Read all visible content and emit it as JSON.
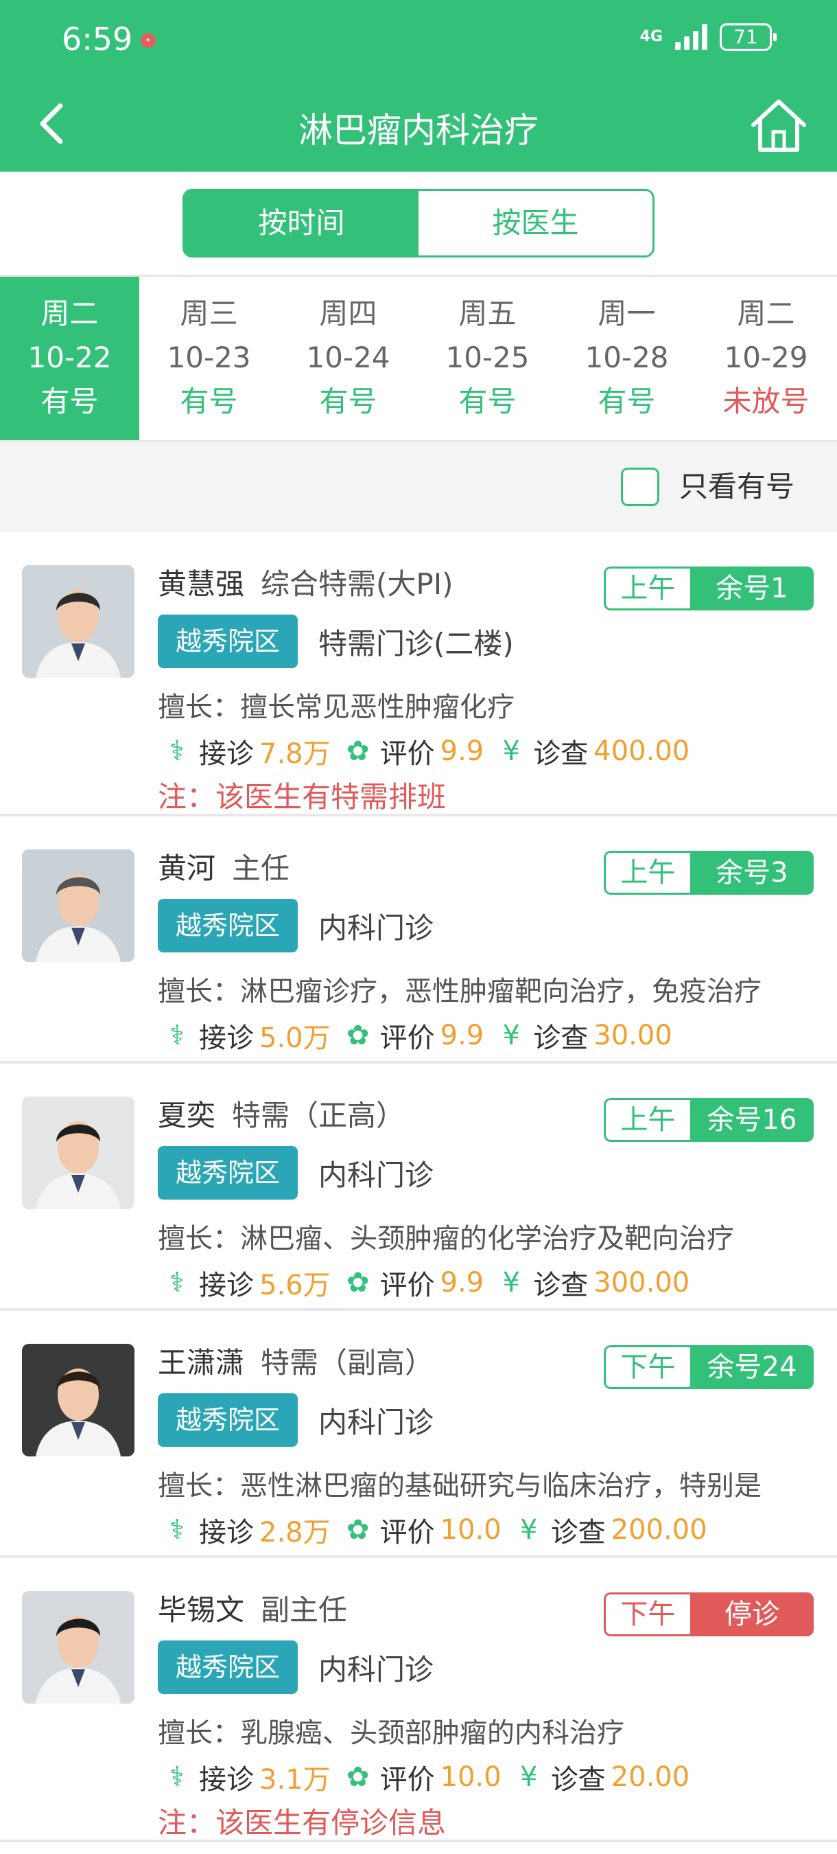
{
  "status_bar": {
    "time": "6:59",
    "network": "4G",
    "battery": "71"
  },
  "nav": {
    "title": "淋巴瘤内科治疗"
  },
  "toggle": {
    "by_time": "按时间",
    "by_doctor": "按医生"
  },
  "dates": [
    {
      "weekday": "周二",
      "date": "10-22",
      "status": "有号",
      "state": "selected"
    },
    {
      "weekday": "周三",
      "date": "10-23",
      "status": "有号",
      "state": "available"
    },
    {
      "weekday": "周四",
      "date": "10-24",
      "status": "有号",
      "state": "available"
    },
    {
      "weekday": "周五",
      "date": "10-25",
      "status": "有号",
      "state": "available"
    },
    {
      "weekday": "周一",
      "date": "10-28",
      "status": "有号",
      "state": "available"
    },
    {
      "weekday": "周二",
      "date": "10-29",
      "status": "未放号",
      "state": "unreleased"
    }
  ],
  "filter": {
    "label": "只看有号",
    "checked": false
  },
  "labels": {
    "visits": "接诊",
    "rating": "评价",
    "fee": "诊查",
    "spec_prefix": "擅长："
  },
  "doctors": [
    {
      "name": "黄慧强",
      "title": "综合特需(大PI)",
      "period": "上午",
      "remain": "余号1",
      "slot_state": "open",
      "campus": "越秀院区",
      "clinic": "特需门诊(二楼)",
      "specialty": "擅长常见恶性肿瘤化疗",
      "visits": "7.8万",
      "rating": "9.9",
      "fee": "400.00",
      "note": "注：该医生有特需排班"
    },
    {
      "name": "黄河",
      "title": "主任",
      "period": "上午",
      "remain": "余号3",
      "slot_state": "open",
      "campus": "越秀院区",
      "clinic": "内科门诊",
      "specialty": "淋巴瘤诊疗，恶性肿瘤靶向治疗，免疫治疗",
      "visits": "5.0万",
      "rating": "9.9",
      "fee": "30.00",
      "note": ""
    },
    {
      "name": "夏奕",
      "title": "特需（正高）",
      "period": "上午",
      "remain": "余号16",
      "slot_state": "open",
      "campus": "越秀院区",
      "clinic": "内科门诊",
      "specialty": "淋巴瘤、头颈肿瘤的化学治疗及靶向治疗",
      "visits": "5.6万",
      "rating": "9.9",
      "fee": "300.00",
      "note": ""
    },
    {
      "name": "王潇潇",
      "title": "特需（副高）",
      "period": "下午",
      "remain": "余号24",
      "slot_state": "open",
      "campus": "越秀院区",
      "clinic": "内科门诊",
      "specialty": "恶性淋巴瘤的基础研究与临床治疗，特别是",
      "visits": "2.8万",
      "rating": "10.0",
      "fee": "200.00",
      "note": ""
    },
    {
      "name": "毕锡文",
      "title": "副主任",
      "period": "下午",
      "remain": "停诊",
      "slot_state": "stopped",
      "campus": "越秀院区",
      "clinic": "内科门诊",
      "specialty": "乳腺癌、头颈部肿瘤的内科治疗",
      "visits": "3.1万",
      "rating": "10.0",
      "fee": "20.00",
      "note": "注：该医生有停诊信息"
    }
  ],
  "colors": {
    "brand": "#33c17a",
    "campus": "#2aa6b6",
    "warning": "#e05a5a",
    "number": "#f0a030"
  },
  "icons": {
    "back": "back-arrow-icon",
    "home": "home-icon",
    "visits": "stethoscope-icon",
    "rating": "badge-icon",
    "fee": "yen-icon"
  }
}
